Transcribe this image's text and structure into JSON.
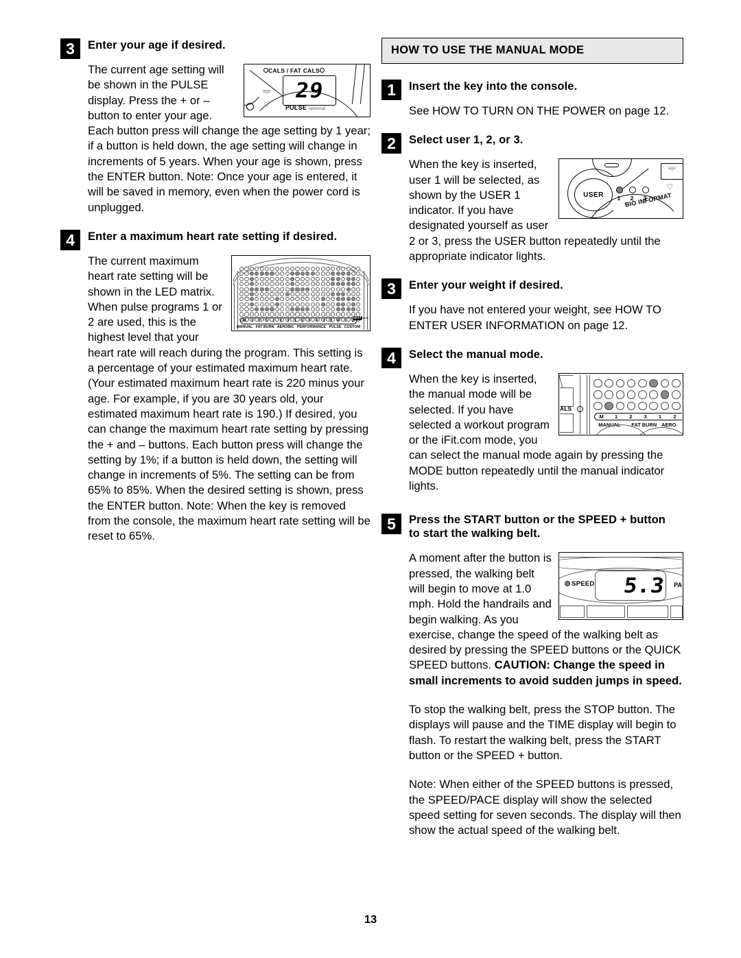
{
  "page": {
    "number": "13"
  },
  "left_column": {
    "step3": {
      "badge": "3",
      "title": "Enter your age if desired.",
      "para_wrap": "The current age setting will be shown in the PULSE display. Press the + or – button to enter your age. Each button press will change the age setting by 1 year; if a button is held down, the age setting will change in increments of 5 years. When your age is shown, press the ENTER button. Note: Once your age is entered, it will be saved in memory, even when the power cord is unplugged.",
      "figure": {
        "name": "age-pulse-display",
        "cals_label": "CALS",
        "slash": "/",
        "fat_cals_label": "FAT CALS",
        "age_label": "age",
        "heart_glyph": "♡",
        "lcd_value": "29",
        "pulse_label": "PULSE",
        "pulse_optional": "optional"
      }
    },
    "step4": {
      "badge": "4",
      "title": "Enter a maximum heart rate setting if desired.",
      "para_wrap": "The current maximum heart rate setting will be shown in the LED matrix. When pulse programs 1 or 2 are used, this is the highest level that your heart rate will reach during the program. This setting is a percentage of your estimated maximum heart rate. (Your estimated maximum heart rate is 220 minus your age. For example, if you are 30 years old, your estimated maximum heart rate is 190.) If desired, you can change the maximum heart rate setting by pressing the + and – buttons. Each button press will change the setting by 1%; if a button is held down, the setting will change in increments of 5%. The setting can be from 65% to 85%. When the desired setting is shown, press the ENTER button. Note: When the key is removed from the console, the maximum heart rate setting will be reset to 65%.",
      "figure": {
        "name": "led-matrix-display",
        "program_numbers": [
          "M",
          "1",
          "2",
          "3",
          "1",
          "2",
          "3",
          "1",
          "2",
          "3",
          "4",
          "1",
          "2",
          "P",
          "1",
          "2"
        ],
        "program_names": [
          "MANUAL",
          "FAT BURN",
          "AEROBIC",
          "PERFORMANCE",
          "PULSE",
          "CUSTOM"
        ],
        "logo": "iFIT",
        "logo_suffix": ".com",
        "led_rows": 11,
        "led_cols": 24,
        "led_pattern": [
          "000000000000000000000000",
          "001111100011111000111100",
          "001000000010000000110110",
          "001000000010000000111110",
          "001111000011110000000100",
          "001000000100000000111000",
          "001000010000000010011110",
          "001000010000000010011010",
          "000111100011110000011110",
          "000000000000000000000000",
          "000000000000000000000000"
        ]
      }
    }
  },
  "right_column": {
    "section_header": "HOW TO USE THE MANUAL MODE",
    "step1": {
      "badge": "1",
      "title": "Insert the key into the console.",
      "para": "See HOW TO TURN ON THE POWER on page 12."
    },
    "step2": {
      "badge": "2",
      "title": "Select user 1, 2, or 3.",
      "para_wrap": "When the key is inserted, user 1 will be selected, as shown by the USER 1 indicator. If you have designated yourself as user 2 or 3, press the USER button repeatedly until the appropriate indicator lights.",
      "figure": {
        "name": "user-indicator-display",
        "user_button_label": "USER",
        "indicator_numbers": [
          "1",
          "2",
          "3"
        ],
        "indicator_active": 1,
        "bio_information_label": "BIO INFORMAT",
        "age_label": "age",
        "heart_glyph": "♡"
      }
    },
    "step3": {
      "badge": "3",
      "title": "Enter your weight if desired.",
      "para": "If you have not entered your weight, see HOW TO ENTER USER INFORMATION on page 12."
    },
    "step4": {
      "badge": "4",
      "title": "Select the manual mode.",
      "para_wrap": "When the key is inserted, the manual mode will be selected. If you have selected a workout program or the iFit.com mode, you can select the manual mode again by pressing the MODE button repeatedly until the manual indicator lights.",
      "figure": {
        "name": "manual-mode-indicator",
        "left_label": "ALS",
        "program_numbers": [
          "M",
          "1",
          "2",
          "3",
          "1",
          "2"
        ],
        "program_names": [
          "MANUAL",
          "FAT BURN",
          "AERO"
        ],
        "led_rows": 3,
        "led_cols": 8,
        "led_pattern": [
          "00000100",
          "00000010",
          "01000000"
        ]
      }
    },
    "step5": {
      "badge": "5",
      "title_line1": "Press the START button or the SPEED + button",
      "title_line2": "to start the walking belt.",
      "para_wrap_pre": "A moment after the button is pressed, the walking belt will begin to move at 1.0 mph. Hold the handrails and begin walking. As you exercise, change the speed of the walking belt as desired by pressing the SPEED buttons or the QUICK SPEED buttons. ",
      "para_wrap_caution": "CAUTION: Change the speed in small increments to avoid sudden jumps in speed.",
      "para2": "To stop the walking belt, press the STOP button. The displays will pause and the TIME display will begin to flash. To restart the walking belt, press the START button or the SPEED + button.",
      "para3": "Note: When either of the SPEED buttons is pressed, the SPEED/PACE display will show the selected speed setting for seven seconds. The display will then show the actual speed of the walking belt.",
      "figure": {
        "name": "speed-pace-display",
        "speed_label": "SPEED",
        "lcd_value": "5.3",
        "pace_label": "PA"
      }
    }
  }
}
